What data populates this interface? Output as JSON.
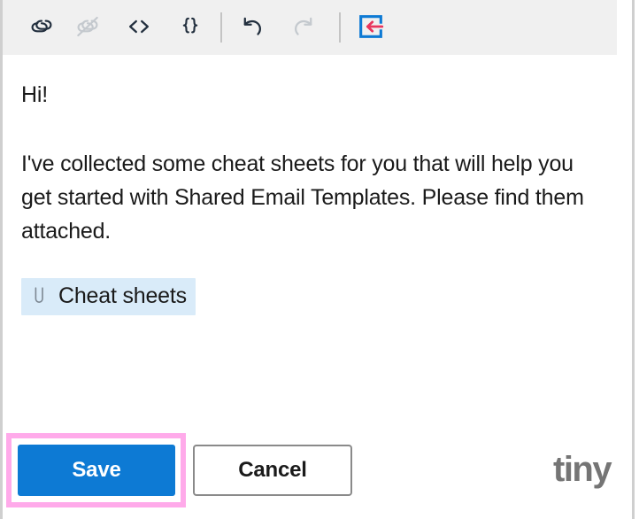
{
  "toolbar": {
    "items": [
      {
        "name": "link",
        "label": "Insert/edit link",
        "icon": "link-icon",
        "disabled": false
      },
      {
        "name": "unlink",
        "label": "Remove link",
        "icon": "unlink-icon",
        "disabled": true
      },
      {
        "name": "source-code",
        "label": "Source code",
        "icon": "code-angle-brackets-icon",
        "disabled": false
      },
      {
        "name": "merge-fields",
        "label": "Merge fields",
        "icon": "curly-braces-icon",
        "disabled": false
      },
      {
        "name": "undo",
        "label": "Undo",
        "icon": "undo-arrow-icon",
        "disabled": false
      },
      {
        "name": "redo",
        "label": "Redo",
        "icon": "redo-arrow-icon",
        "disabled": true
      },
      {
        "name": "insert-template",
        "label": "Insert template",
        "icon": "insert-into-box-arrow-icon",
        "disabled": false
      }
    ]
  },
  "editor": {
    "greeting": "Hi!",
    "paragraph": "I've collected some cheat sheets for you that will help you get started with Shared Email Templates. Please find them attached.",
    "attachment": {
      "label": "Cheat sheets",
      "icon": "paperclip-icon"
    }
  },
  "footer": {
    "save_label": "Save",
    "cancel_label": "Cancel",
    "brand": "tiny"
  },
  "colors": {
    "toolbar_background": "#f0f0f0",
    "editor_background": "#ffffff",
    "save_button": "#0d7ad4",
    "save_highlight": "#ffaaea",
    "cancel_border": "#8a8a8a",
    "attachment_background": "#d9ebf9",
    "text": "#1a1a1a",
    "icon_enabled": "#222f3e",
    "icon_disabled": "#8f9aa6",
    "insert_icon_box": "#0d7ad4",
    "insert_icon_arrow": "#e8365d",
    "brand": "#757575",
    "frame_border": "#cfcfcf"
  }
}
